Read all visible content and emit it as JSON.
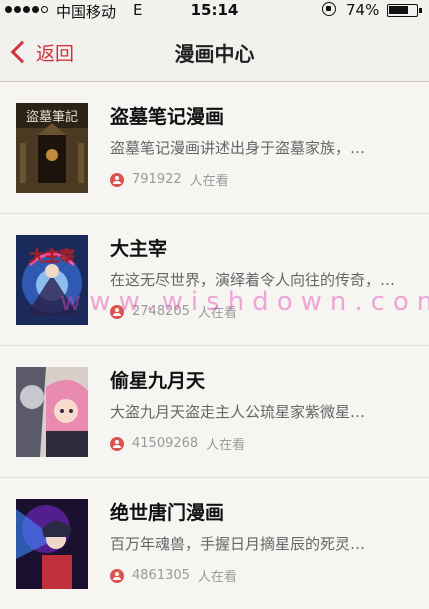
{
  "status_bar": {
    "carrier": "中国移动",
    "network": "E",
    "time": "15:14",
    "battery_percent": "74%",
    "battery_level": 0.74,
    "signal_dots_filled": 4
  },
  "nav": {
    "back_label": "返回",
    "title": "漫画中心"
  },
  "items": [
    {
      "title": "盗墓笔记漫画",
      "description": "盗墓笔记漫画讲述出身于盗墓家族，…",
      "views": "791922",
      "views_suffix": "人在看",
      "cover_text": "盜墓筆記"
    },
    {
      "title": "大主宰",
      "description": "在这无尽世界，演绎着令人向往的传奇，…",
      "views": "2748205",
      "views_suffix": "人在看",
      "cover_text": "大主宰"
    },
    {
      "title": "偷星九月天",
      "description": "大盗九月天盗走主人公琉星家紫微星…",
      "views": "41509268",
      "views_suffix": "人在看"
    },
    {
      "title": "绝世唐门漫画",
      "description": "百万年魂兽，手握日月摘星辰的死灵…",
      "views": "4861305",
      "views_suffix": "人在看"
    }
  ],
  "watermark": "www.wishdown.com",
  "colors": {
    "accent": "#d2343f",
    "view_icon": "#d9534f"
  }
}
